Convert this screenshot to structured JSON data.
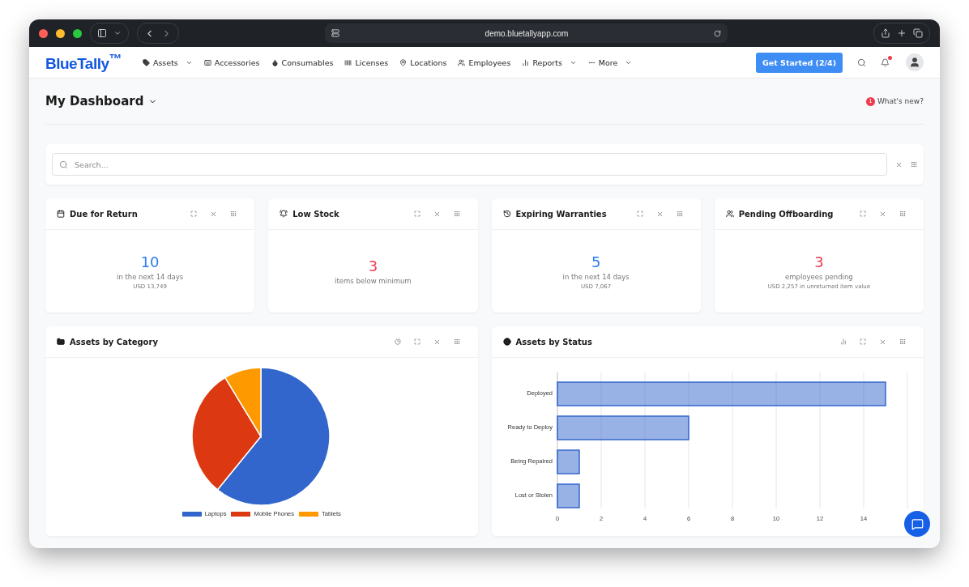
{
  "browser": {
    "url": "demo.bluetallyapp.com"
  },
  "nav": {
    "logo": "BlueTally$^{™}$",
    "items": [
      {
        "label": "Assets",
        "dropdown": true
      },
      {
        "label": "Accessories",
        "dropdown": false
      },
      {
        "label": "Consumables",
        "dropdown": false
      },
      {
        "label": "Licenses",
        "dropdown": false
      },
      {
        "label": "Locations",
        "dropdown": false
      },
      {
        "label": "Employees",
        "dropdown": false
      },
      {
        "label": "Reports",
        "dropdown": true
      },
      {
        "label": "More",
        "dropdown": true
      }
    ],
    "cta": "Get Started (2/4)",
    "notification_unread": true
  },
  "dashboard": {
    "title": "My Dashboard",
    "whats_new": {
      "badge": "1",
      "label": "What's new?"
    }
  },
  "search": {
    "placeholder": "Search..."
  },
  "stat_widgets": [
    {
      "title": "Due for Return",
      "value": "10",
      "color": "#2b7bf0",
      "caption": "in the next 14 days",
      "note": "USD 13,749"
    },
    {
      "title": "Low Stock",
      "value": "3",
      "color": "#ef3b4f",
      "caption": "items below minimum"
    },
    {
      "title": "Expiring Warranties",
      "value": "5",
      "color": "#2b7bf0",
      "caption": "in the next 14 days",
      "note": "USD 7,067"
    },
    {
      "title": "Pending Offboarding",
      "value": "3",
      "color": "#ef3b4f",
      "caption": "employees pending",
      "note": "USD 2,257 in unreturned item value"
    }
  ],
  "category_widget": {
    "title": "Assets by Category",
    "legend": [
      {
        "label": "Laptops",
        "color": "#3366cc"
      },
      {
        "label": "Mobile Phones",
        "color": "#dc3912"
      },
      {
        "label": "Tablets",
        "color": "#ff9900"
      }
    ]
  },
  "status_widget": {
    "title": "Assets by Status",
    "chart_data": {
      "type": "bar",
      "orientation": "horizontal",
      "categories": [
        "Deployed",
        "Ready to Deploy",
        "Being Repaired",
        "Lost or Stolen"
      ],
      "values": [
        15,
        6,
        1,
        1
      ],
      "grid": true,
      "xlim": [
        0,
        16
      ],
      "xticks": [
        0,
        2,
        4,
        6,
        8,
        10,
        12,
        14
      ]
    }
  }
}
